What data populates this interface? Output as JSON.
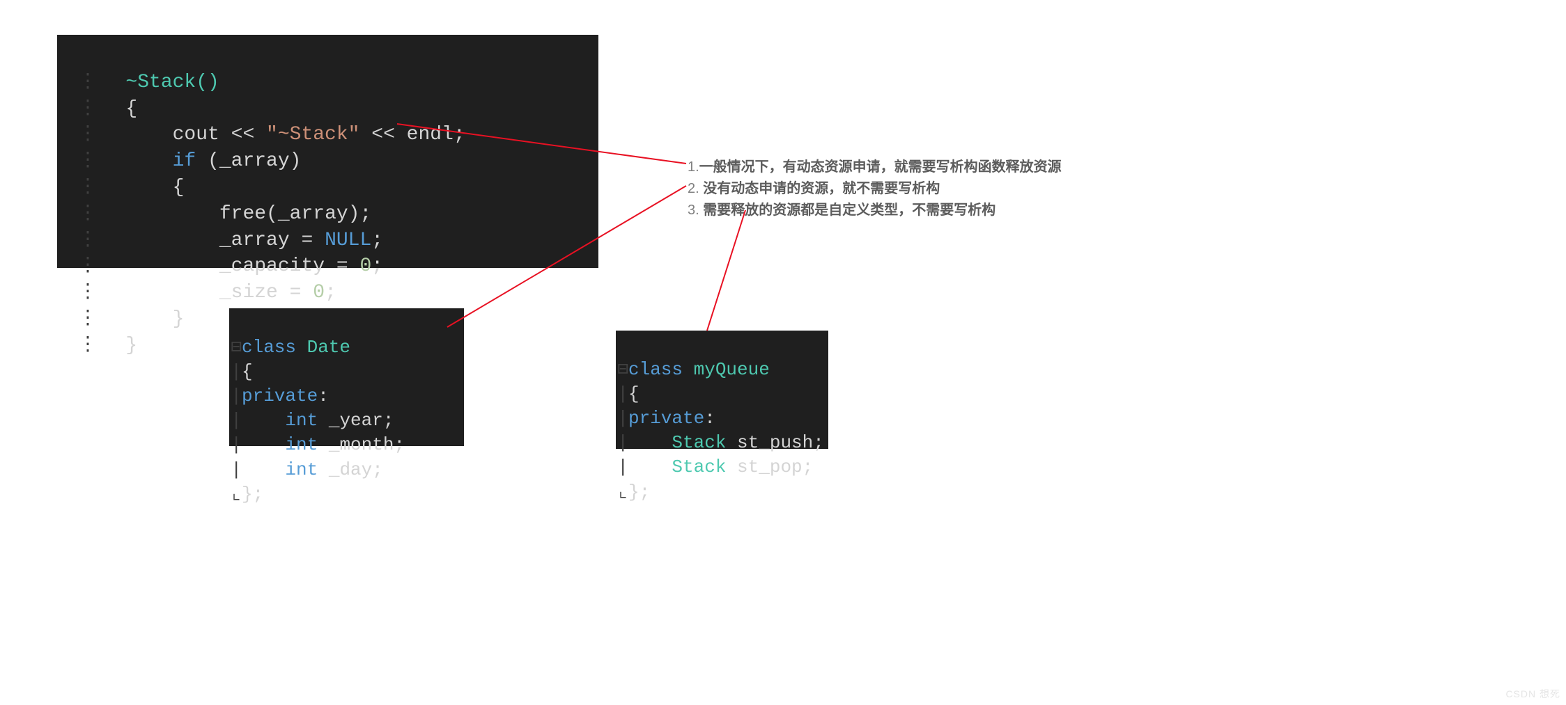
{
  "block1": {
    "l1_func": "~Stack()",
    "l2": "{",
    "l3_a": "cout << ",
    "l3_str": "\"~Stack\"",
    "l3_b": " << endl;",
    "l4_kw": "if",
    "l4_b": " (_array)",
    "l5": "{",
    "l6": "free(_array);",
    "l7_a": "_array = ",
    "l7_nul": "NULL",
    "l7_b": ";",
    "l8_a": "_capacity = ",
    "l8_num": "0",
    "l8_b": ";",
    "l9_a": "_size = ",
    "l9_num": "0",
    "l9_b": ";",
    "l10": "}",
    "l11": "}"
  },
  "block2": {
    "l1_kw": "class",
    "l1_name": "Date",
    "l2": "{",
    "l3_kw": "private",
    "l3_b": ":",
    "l4_t": "int",
    "l4_v": " _year;",
    "l5_t": "int",
    "l5_v": " _month;",
    "l6_t": "int",
    "l6_v": " _day;",
    "l7": "};"
  },
  "block3": {
    "l1_kw": "class",
    "l1_name": "myQueue",
    "l2": "{",
    "l3_kw": "private",
    "l3_b": ":",
    "l4_t": "Stack",
    "l4_v": " st_push;",
    "l5_t": "Stack",
    "l5_v": " st_pop;",
    "l6": "};"
  },
  "notes": {
    "n1_num": "1.",
    "n1": "一般情况下，有动态资源申请，就需要写析构函数释放资源",
    "n2_num": "2.",
    "n2": " 没有动态申请的资源，就不需要写析构",
    "n3_num": "3.",
    "n3": " 需要释放的资源都是自定义类型，不需要写析构"
  },
  "watermark": "CSDN 想死"
}
